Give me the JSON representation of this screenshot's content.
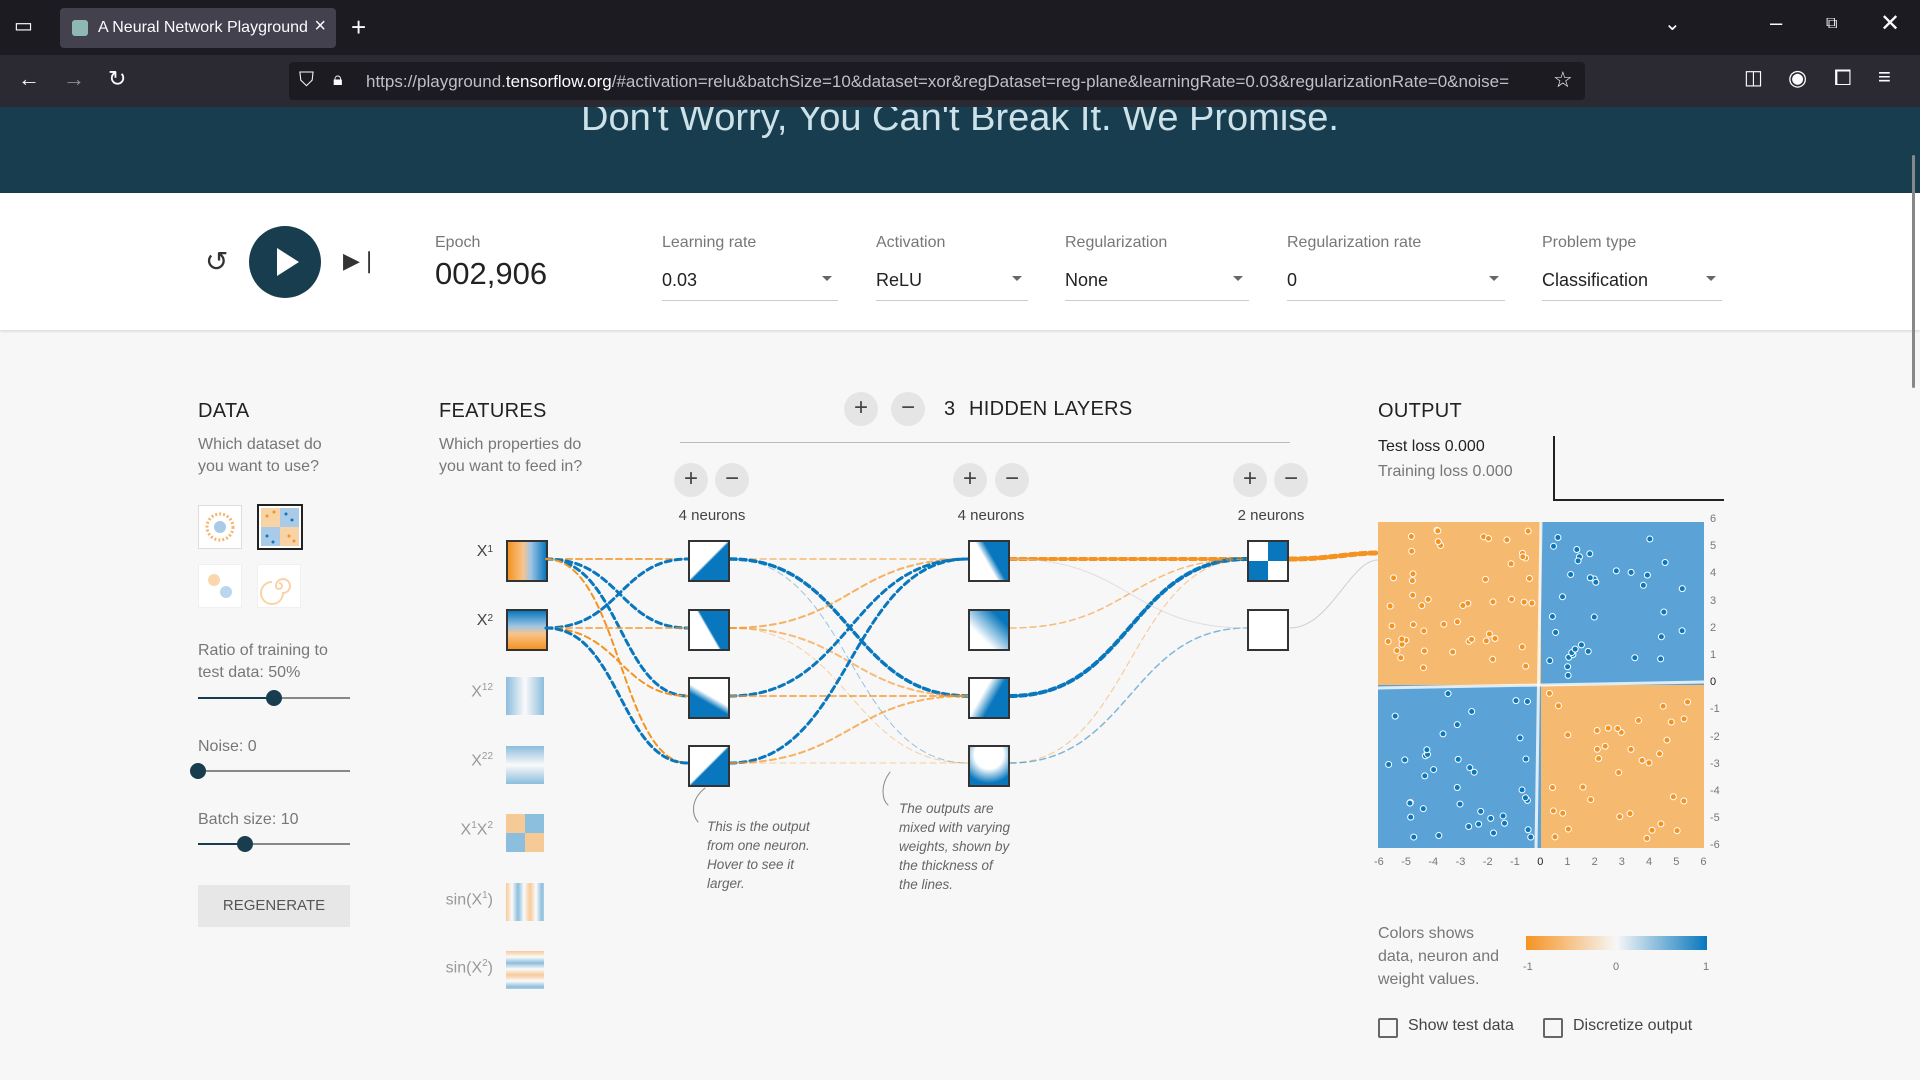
{
  "browser": {
    "tab_title": "A Neural Network Playground",
    "url_prefix": "https://playground.",
    "url_domain": "tensorflow.org",
    "url_rest": "/#activation=relu&batchSize=10&dataset=xor&regDataset=reg-plane&learningRate=0.03&regularizationRate=0&noise=",
    "icons": [
      "tab-list-icon",
      "close-icon",
      "new-tab-icon",
      "chevron-down-icon",
      "minimize-icon",
      "restore-icon",
      "window-close-icon",
      "back-icon",
      "forward-icon",
      "reload-icon",
      "shield-icon",
      "lock-icon",
      "star-icon",
      "pocket-icon",
      "account-icon",
      "extensions-icon",
      "menu-icon"
    ]
  },
  "banner": {
    "motto": "Don't Worry, You Can't Break It. We Promise."
  },
  "controls": {
    "epoch_label": "Epoch",
    "epoch_value": "002,906",
    "learning_rate_label": "Learning rate",
    "learning_rate_value": "0.03",
    "activation_label": "Activation",
    "activation_value": "ReLU",
    "regularization_label": "Regularization",
    "regularization_value": "None",
    "regularization_rate_label": "Regularization rate",
    "regularization_rate_value": "0",
    "problem_type_label": "Problem type",
    "problem_type_value": "Classification"
  },
  "data_panel": {
    "heading": "DATA",
    "subtitle_line1": "Which dataset do",
    "subtitle_line2": "you want to use?",
    "ratio_label_line1": "Ratio of training to",
    "ratio_label_line2": "test data:  50%",
    "ratio_value": 50,
    "noise_label": "Noise:  0",
    "noise_value": 0,
    "batch_label": "Batch size:  10",
    "batch_value": 10,
    "regenerate": "REGENERATE"
  },
  "features_panel": {
    "heading": "FEATURES",
    "subtitle_line1": "Which properties do",
    "subtitle_line2": "you want to feed in?",
    "features": [
      {
        "label": "X1",
        "base": "X",
        "sub": "1",
        "sup": "",
        "active": true
      },
      {
        "label": "X2",
        "base": "X",
        "sub": "2",
        "sup": "",
        "active": true
      },
      {
        "label": "X1²",
        "base": "X",
        "sub": "1",
        "sup": "2",
        "active": false
      },
      {
        "label": "X2²",
        "base": "X",
        "sub": "2",
        "sup": "2",
        "active": false
      },
      {
        "label": "X1X2",
        "base": "X",
        "sub": "1",
        "sup": "",
        "active": false
      },
      {
        "label": "sin(X1)",
        "base": "sin(X",
        "sub": "1",
        "sup": "",
        "active": false
      },
      {
        "label": "sin(X2)",
        "base": "sin(X",
        "sub": "2",
        "sup": "",
        "active": false
      }
    ]
  },
  "network": {
    "hidden_layers_count": "3",
    "hidden_layers_label": "HIDDEN LAYERS",
    "layers": [
      {
        "neurons_label": "4 neurons"
      },
      {
        "neurons_label": "4 neurons"
      },
      {
        "neurons_label": "2 neurons"
      }
    ],
    "note1": [
      "This is the output",
      "from one neuron.",
      "Hover to see it",
      "larger."
    ],
    "note2": [
      "The outputs are",
      "mixed with varying",
      "weights, shown by",
      "the thickness of",
      "the lines."
    ]
  },
  "output_panel": {
    "heading": "OUTPUT",
    "test_loss": "Test loss 0.000",
    "training_loss": "Training loss 0.000",
    "legend_line1": "Colors shows",
    "legend_line2": "data, neuron and",
    "legend_line3": "weight values.",
    "legend_min": "-1",
    "legend_mid": "0",
    "legend_max": "1",
    "show_test_data": "Show test data",
    "discretize_output": "Discretize output",
    "x_ticks": [
      "-6",
      "-5",
      "-4",
      "-3",
      "-2",
      "-1",
      "0",
      "1",
      "2",
      "3",
      "4",
      "5",
      "6"
    ],
    "y_ticks": [
      "6",
      "5",
      "4",
      "3",
      "2",
      "1",
      "0",
      "-1",
      "-2",
      "-3",
      "-4",
      "-5",
      "-6"
    ]
  },
  "colors": {
    "orange": "#f59322",
    "blue": "#0877bd",
    "dark": "#183d4e"
  }
}
